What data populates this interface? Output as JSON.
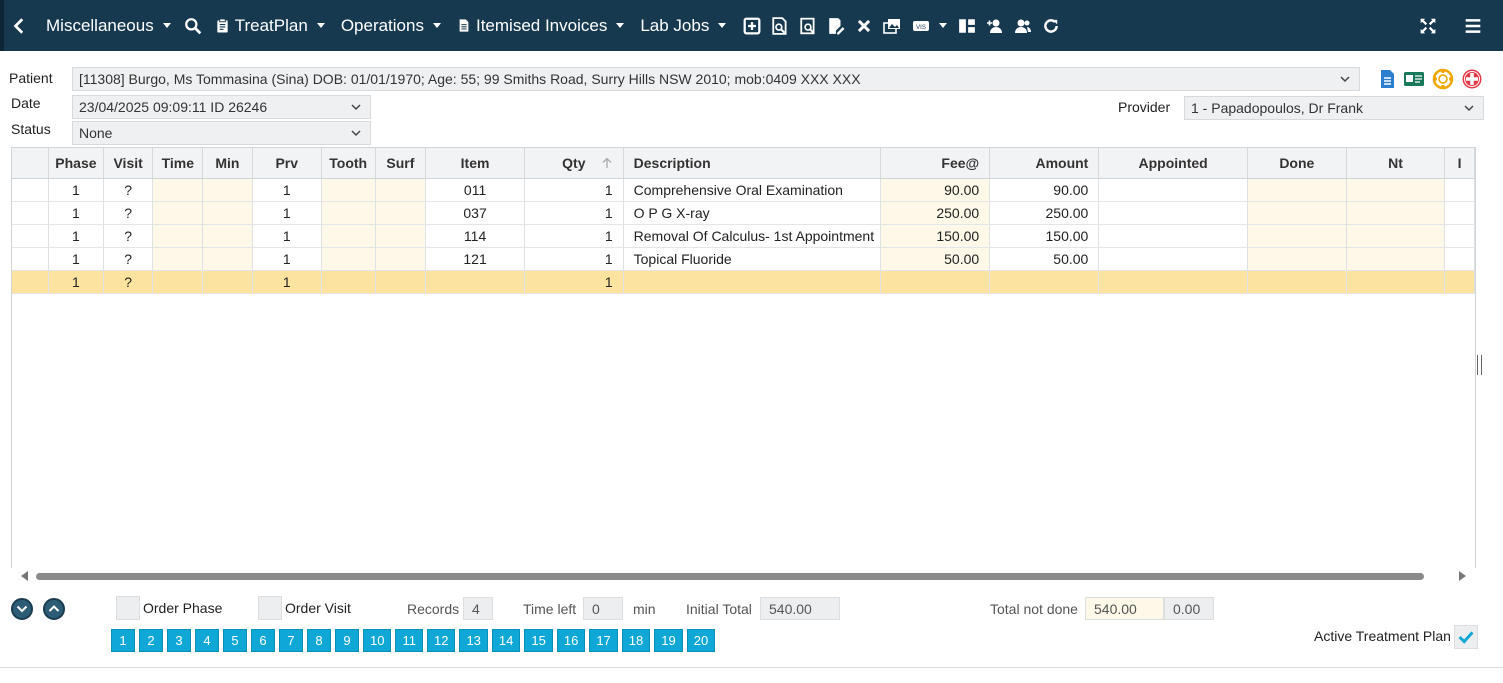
{
  "toolbar": {
    "misc_label": "Miscellaneous",
    "treatplan_label": "TreatPlan",
    "operations_label": "Operations",
    "invoices_label": "Itemised Invoices",
    "labjobs_label": "Lab Jobs"
  },
  "header": {
    "patient_label": "Patient",
    "patient_value": "[11308] Burgo, Ms Tommasina (Sina) DOB: 01/01/1970; Age: 55; 99 Smiths Road, Surry Hills NSW 2010; mob:0409 XXX XXX",
    "date_label": "Date",
    "date_value": "23/04/2025 09:09:11 ID 26246",
    "status_label": "Status",
    "status_value": "None",
    "provider_label": "Provider",
    "provider_value": "1 - Papadopoulos, Dr Frank"
  },
  "table": {
    "columns": [
      "",
      "Phase",
      "Visit",
      "Time",
      "Min",
      "Prv",
      "Tooth",
      "Surf",
      "Item",
      "Qty",
      "Description",
      "Fee@",
      "Amount",
      "Appointed",
      "Done",
      "Nt",
      "I"
    ],
    "rows": [
      [
        "",
        "1",
        "?",
        "",
        "",
        "1",
        "",
        "",
        "011",
        "1",
        "Comprehensive Oral Examination",
        "90.00",
        "90.00",
        "",
        "",
        "",
        ""
      ],
      [
        "",
        "1",
        "?",
        "",
        "",
        "1",
        "",
        "",
        "037",
        "1",
        "O P G X-ray",
        "250.00",
        "250.00",
        "",
        "",
        "",
        ""
      ],
      [
        "",
        "1",
        "?",
        "",
        "",
        "1",
        "",
        "",
        "114",
        "1",
        "Removal Of Calculus- 1st Appointment",
        "150.00",
        "150.00",
        "",
        "",
        "",
        ""
      ],
      [
        "",
        "1",
        "?",
        "",
        "",
        "1",
        "",
        "",
        "121",
        "1",
        "Topical Fluoride",
        "50.00",
        "50.00",
        "",
        "",
        "",
        ""
      ],
      [
        "",
        "1",
        "?",
        "",
        "",
        "1",
        "",
        "",
        "",
        "1",
        "",
        "",
        "",
        "",
        "",
        "",
        ""
      ]
    ]
  },
  "footer": {
    "order_phase_label": "Order Phase",
    "order_visit_label": "Order Visit",
    "records_label": "Records",
    "records_value": "4",
    "time_left_label": "Time left",
    "time_left_value": "0",
    "min_label": "min",
    "initial_total_label": "Initial Total",
    "initial_total_value": "540.00",
    "total_not_done_label": "Total not done",
    "total_not_done_value": "540.00",
    "total_extra_value": "0.00",
    "active_plan_label": "Active Treatment Plan",
    "active_plan_checked": true,
    "pages": [
      "1",
      "2",
      "3",
      "4",
      "5",
      "6",
      "7",
      "8",
      "9",
      "10",
      "11",
      "12",
      "13",
      "14",
      "15",
      "16",
      "17",
      "18",
      "19",
      "20"
    ]
  },
  "colors": {
    "topbar": "#17394f",
    "selected_row": "#fde3a0",
    "editable_cell": "#fdf8e8",
    "page_button": "#0fa7d6"
  }
}
